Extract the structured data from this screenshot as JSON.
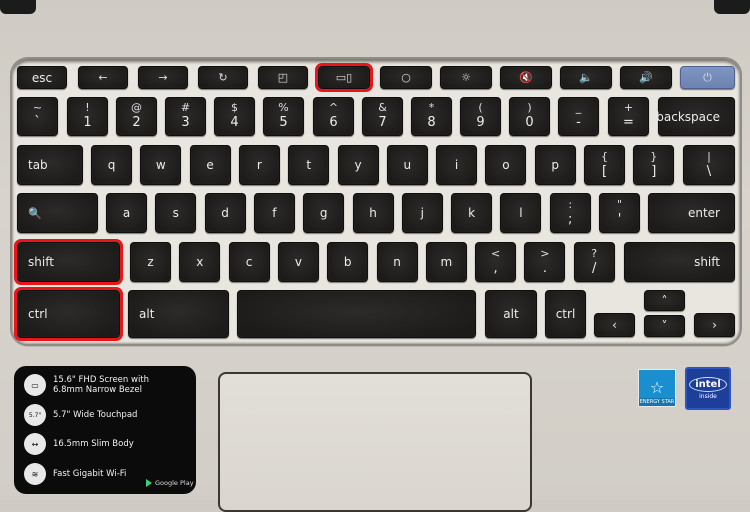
{
  "keyboard": {
    "function_row": [
      {
        "id": "esc",
        "label": "esc",
        "icon": null
      },
      {
        "id": "back",
        "label": "",
        "icon": "arrow-left-icon",
        "glyph": "←"
      },
      {
        "id": "forward",
        "label": "",
        "icon": "arrow-right-icon",
        "glyph": "→"
      },
      {
        "id": "refresh",
        "label": "",
        "icon": "refresh-icon",
        "glyph": "↻"
      },
      {
        "id": "fullscreen",
        "label": "",
        "icon": "fullscreen-icon",
        "glyph": "◰"
      },
      {
        "id": "overview",
        "label": "",
        "icon": "overview-icon",
        "glyph": "▭▯",
        "highlighted": true
      },
      {
        "id": "brightness-down",
        "label": "",
        "icon": "brightness-down-icon",
        "glyph": "○"
      },
      {
        "id": "brightness-up",
        "label": "",
        "icon": "brightness-up-icon",
        "glyph": "☼"
      },
      {
        "id": "mute",
        "label": "",
        "icon": "mute-icon",
        "glyph": "🔇"
      },
      {
        "id": "volume-down",
        "label": "",
        "icon": "volume-down-icon",
        "glyph": "🔈"
      },
      {
        "id": "volume-up",
        "label": "",
        "icon": "volume-up-icon",
        "glyph": "🔊"
      },
      {
        "id": "power",
        "label": "",
        "icon": "power-icon",
        "glyph": "⏻"
      }
    ],
    "number_row": [
      {
        "top": "~",
        "bottom": "`"
      },
      {
        "top": "!",
        "bottom": "1"
      },
      {
        "top": "@",
        "bottom": "2"
      },
      {
        "top": "#",
        "bottom": "3"
      },
      {
        "top": "$",
        "bottom": "4"
      },
      {
        "top": "%",
        "bottom": "5"
      },
      {
        "top": "^",
        "bottom": "6"
      },
      {
        "top": "&",
        "bottom": "7"
      },
      {
        "top": "*",
        "bottom": "8"
      },
      {
        "top": "(",
        "bottom": "9"
      },
      {
        "top": ")",
        "bottom": "0"
      },
      {
        "top": "_",
        "bottom": "-"
      },
      {
        "top": "+",
        "bottom": "="
      },
      {
        "label": "backspace"
      }
    ],
    "tab_row": [
      {
        "label": "tab"
      },
      {
        "label": "q"
      },
      {
        "label": "w"
      },
      {
        "label": "e"
      },
      {
        "label": "r"
      },
      {
        "label": "t"
      },
      {
        "label": "y"
      },
      {
        "label": "u"
      },
      {
        "label": "i"
      },
      {
        "label": "o"
      },
      {
        "label": "p"
      },
      {
        "top": "{",
        "bottom": "["
      },
      {
        "top": "}",
        "bottom": "]"
      },
      {
        "top": "|",
        "bottom": "\\"
      }
    ],
    "home_row": [
      {
        "label": "",
        "icon": "search-icon",
        "glyph": "🔍"
      },
      {
        "label": "a"
      },
      {
        "label": "s"
      },
      {
        "label": "d"
      },
      {
        "label": "f"
      },
      {
        "label": "g"
      },
      {
        "label": "h"
      },
      {
        "label": "j"
      },
      {
        "label": "k"
      },
      {
        "label": "l"
      },
      {
        "top": ":",
        "bottom": ";"
      },
      {
        "top": "\"",
        "bottom": "'"
      },
      {
        "label": "enter"
      }
    ],
    "shift_row": [
      {
        "label": "shift",
        "highlighted": true
      },
      {
        "label": "z"
      },
      {
        "label": "x"
      },
      {
        "label": "c"
      },
      {
        "label": "v"
      },
      {
        "label": "b"
      },
      {
        "label": "n"
      },
      {
        "label": "m"
      },
      {
        "top": "<",
        "bottom": ","
      },
      {
        "top": ">",
        "bottom": "."
      },
      {
        "top": "?",
        "bottom": "/"
      },
      {
        "label": "shift"
      }
    ],
    "bottom_row": [
      {
        "label": "ctrl",
        "highlighted": true
      },
      {
        "label": "alt"
      },
      {
        "label": ""
      },
      {
        "label": "alt"
      },
      {
        "label": "ctrl"
      }
    ],
    "arrows": {
      "left": "‹",
      "up": "˄",
      "down": "˅",
      "right": "›"
    }
  },
  "spec_card": {
    "items": [
      {
        "icon": "screen-icon",
        "glyph": "▭",
        "text": "15.6\" FHD Screen with 6.8mm Narrow Bezel"
      },
      {
        "icon": "touchpad-icon",
        "glyph": "5.7\"",
        "text": "5.7\" Wide Touchpad"
      },
      {
        "icon": "slim-body-icon",
        "glyph": "↔",
        "text": "16.5mm Slim Body"
      },
      {
        "icon": "wifi-icon",
        "glyph": "≋",
        "text": "Fast Gigabit Wi-Fi"
      }
    ],
    "store_label": "Google Play"
  },
  "badges": {
    "energy_star": {
      "text": "ENERGY STAR",
      "glyph": "☆"
    },
    "intel": {
      "brand": "intel",
      "sub": "inside"
    }
  },
  "colors": {
    "highlight": "#e8161a",
    "power_key": "#7389b8",
    "key": "#1f1e1c",
    "chassis": "#d4d0c9"
  }
}
